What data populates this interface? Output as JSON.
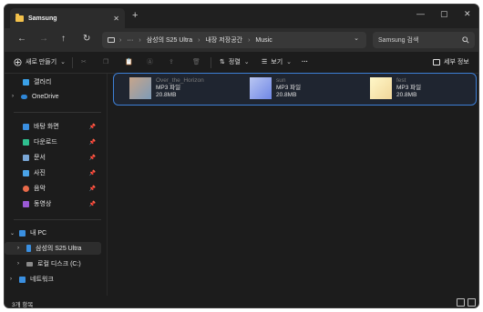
{
  "tab": {
    "title": "Samsung",
    "close": "✕"
  },
  "new_tab": "+",
  "window_controls": {
    "minimize": "—",
    "maximize": "▢",
    "close": "✕"
  },
  "nav": {
    "back": "←",
    "forward": "→",
    "up": "↑",
    "refresh": "↻"
  },
  "address": {
    "more": "···",
    "crumbs": [
      "삼성의 S25 Ultra",
      "내장 저장공간",
      "Music"
    ],
    "separator": "›",
    "expand": "⌄"
  },
  "search": {
    "placeholder": "Samsung 검색",
    "icon": "search-icon"
  },
  "toolbar": {
    "new_label": "새로 만들기",
    "sort_label": "정렬",
    "view_label": "보기",
    "more_label": "···",
    "details_label": "세부 정보"
  },
  "sidebar": {
    "top": [
      {
        "label": "갤러리",
        "icon": "gallery-icon",
        "color": "#3aa0e8"
      },
      {
        "label": "OneDrive",
        "icon": "cloud-icon",
        "color": "#2f86d6"
      }
    ],
    "pinned": [
      {
        "label": "바탕 화면",
        "icon": "desktop-icon",
        "color": "#3a8fe0"
      },
      {
        "label": "다운로드",
        "icon": "download-icon",
        "color": "#2fbf8f"
      },
      {
        "label": "문서",
        "icon": "document-icon",
        "color": "#7aa7d6"
      },
      {
        "label": "사진",
        "icon": "pictures-icon",
        "color": "#4aa3e8"
      },
      {
        "label": "음악",
        "icon": "music-icon",
        "color": "#e86a4a"
      },
      {
        "label": "동영상",
        "icon": "video-icon",
        "color": "#9a5ad6"
      }
    ],
    "pin_glyph": "📌",
    "tree": [
      {
        "label": "내 PC",
        "icon": "pc-icon",
        "color": "#3a8fe0",
        "chevron": "⌄"
      },
      {
        "label": "삼성의 S25 Ultra",
        "icon": "phone-icon",
        "color": "#3a8fe0",
        "chevron": "›"
      },
      {
        "label": "로컬 디스크 (C:)",
        "icon": "drive-icon",
        "color": "#8a8a8a",
        "chevron": "›"
      },
      {
        "label": "네트워크",
        "icon": "network-icon",
        "color": "#3a8fe0",
        "chevron": "›"
      }
    ]
  },
  "files": [
    {
      "name": "Over_the_Horizon",
      "type": "MP3 파일",
      "size": "20.8MB",
      "thumb_colors": [
        "#c7a58a",
        "#7d9bb8"
      ]
    },
    {
      "name": "sun",
      "type": "MP3 파일",
      "size": "20.8MB",
      "thumb_colors": [
        "#b9c6f2",
        "#6f87e6"
      ]
    },
    {
      "name": "fest",
      "type": "MP3 파일",
      "size": "20.8MB",
      "thumb_colors": [
        "#fff7c8",
        "#f1d79a"
      ]
    }
  ],
  "status": {
    "count": "3개 항목"
  },
  "colors": {
    "accent": "#3d7fd6",
    "background": "#1c1c1c"
  }
}
